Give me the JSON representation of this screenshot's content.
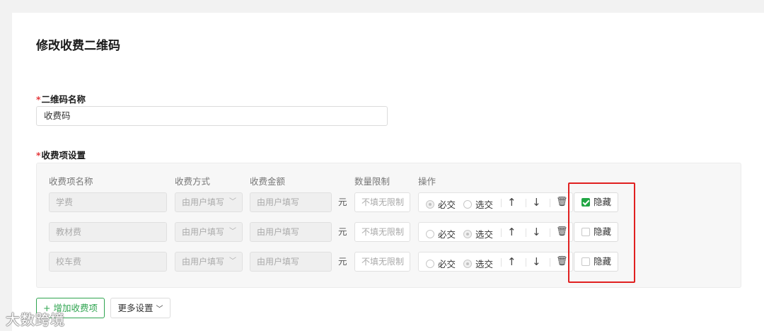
{
  "page": {
    "title": "修改收费二维码"
  },
  "form": {
    "required_mark": "*",
    "name_label": "二维码名称",
    "name_value": "收费码",
    "items_label": "收费项设置"
  },
  "table": {
    "headers": [
      "收费项名称",
      "收费方式",
      "收费金额",
      "数量限制",
      "操作"
    ],
    "rows": [
      {
        "name": "学费",
        "method": "由用户填写",
        "amount": "由用户填写",
        "unit": "元",
        "limit": "不填无限制",
        "mandatory": true,
        "hidden": true
      },
      {
        "name": "教材费",
        "method": "由用户填写",
        "amount": "由用户填写",
        "unit": "元",
        "limit": "不填无限制",
        "mandatory": false,
        "hidden": false
      },
      {
        "name": "校车费",
        "method": "由用户填写",
        "amount": "由用户填写",
        "unit": "元",
        "limit": "不填无限制",
        "mandatory": false,
        "hidden": false
      }
    ],
    "option_required": "必交",
    "option_optional": "选交",
    "hide_label": "隐藏"
  },
  "actions": {
    "add_item": "+ 增加收费项",
    "more_settings": "更多设置"
  },
  "watermark": "大数跨境",
  "icons": {
    "chevron": "chevron-down-icon",
    "up": "arrow-up-icon",
    "down": "arrow-down-icon",
    "delete": "trash-icon",
    "check": "check-icon"
  },
  "colors": {
    "accent_green": "#2ea44f",
    "highlight_red": "#e02020",
    "required_red": "#e4393c"
  }
}
